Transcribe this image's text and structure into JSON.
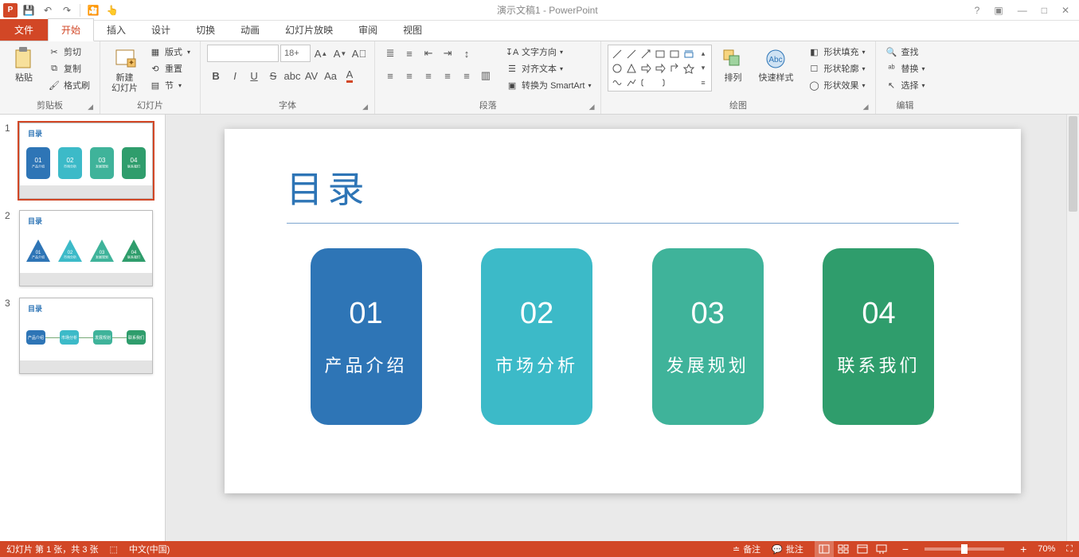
{
  "app": {
    "title": "演示文稿1 - PowerPoint"
  },
  "window_controls": {
    "help": "?",
    "restore": "▣",
    "minimize": "—",
    "maximize": "□",
    "close": "✕"
  },
  "qat": {
    "save": "💾",
    "undo": "↶",
    "redo": "↷",
    "start": "▶",
    "touch": "☝"
  },
  "tabs": {
    "file": "文件",
    "home": "开始",
    "insert": "插入",
    "design": "设计",
    "transitions": "切换",
    "animations": "动画",
    "slideshow": "幻灯片放映",
    "review": "审阅",
    "view": "视图"
  },
  "ribbon": {
    "clipboard": {
      "label": "剪贴板",
      "paste": "粘贴",
      "cut": "剪切",
      "copy": "复制",
      "formatpainter": "格式刷"
    },
    "slides": {
      "label": "幻灯片",
      "new": "新建\n幻灯片",
      "layout": "版式",
      "reset": "重置",
      "section": "节"
    },
    "font": {
      "label": "字体",
      "size": "18+"
    },
    "paragraph": {
      "label": "段落",
      "textdir": "文字方向",
      "align": "对齐文本",
      "smartart": "转换为 SmartArt"
    },
    "drawing": {
      "label": "绘图",
      "arrange": "排列",
      "quickstyle": "快速样式",
      "fill": "形状填充",
      "outline": "形状轮廓",
      "effects": "形状效果"
    },
    "editing": {
      "label": "编辑",
      "find": "查找",
      "replace": "替换",
      "select": "选择"
    }
  },
  "slide": {
    "title": "目录",
    "cards": [
      {
        "num": "01",
        "text": "产品介绍",
        "colorClass": "c1"
      },
      {
        "num": "02",
        "text": "市场分析",
        "colorClass": "c2"
      },
      {
        "num": "03",
        "text": "发展规划",
        "colorClass": "c3"
      },
      {
        "num": "04",
        "text": "联系我们",
        "colorClass": "c4"
      }
    ]
  },
  "thumbs": {
    "count": 3,
    "selected": 1,
    "title": "目录"
  },
  "status": {
    "slideinfo": "幻灯片 第 1 张，共 3 张",
    "lang": "中文(中国)",
    "notes": "备注",
    "comments": "批注",
    "zoom": "70%",
    "minus": "−",
    "plus": "+"
  }
}
